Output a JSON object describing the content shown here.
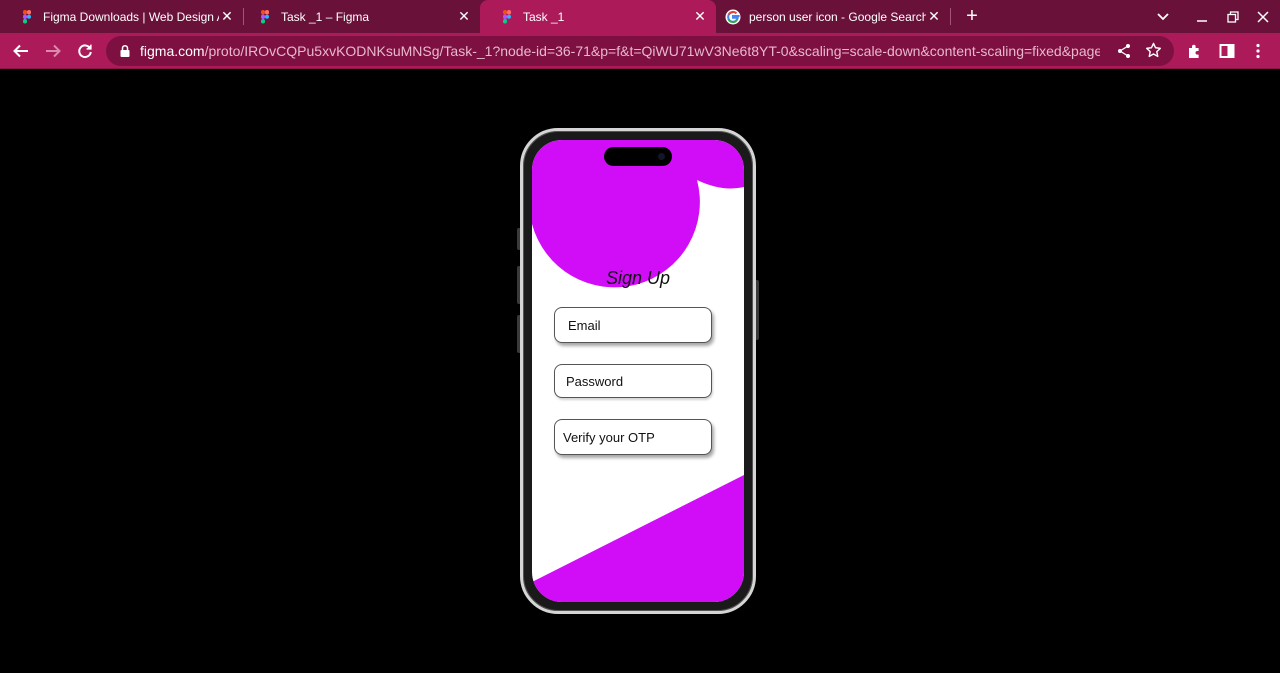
{
  "browser": {
    "tabs": [
      {
        "title": "Figma Downloads | Web Design A",
        "favicon": "figma-icon",
        "active": false
      },
      {
        "title": "Task _1 – Figma",
        "favicon": "figma-icon",
        "active": false
      },
      {
        "title": "Task _1",
        "favicon": "figma-icon",
        "active": true
      },
      {
        "title": "person user icon - Google Search",
        "favicon": "google-icon",
        "active": false
      }
    ],
    "address": {
      "host": "figma.com",
      "path": "/proto/IROvCQPu5xvKODNKsuMNSg/Task-_1?node-id=36-71&p=f&t=QiWU71wV3Ne6t8YT-0&scaling=scale-down&content-scaling=fixed&page-id..."
    }
  },
  "colors": {
    "tabstrip": "#6a1139",
    "toolbar": "#ac1a5a",
    "accent": "#d10cf7"
  },
  "signup": {
    "heading": "Sign Up",
    "fields": {
      "email": "Email",
      "password": "Password",
      "otp": "Verify your OTP"
    }
  }
}
